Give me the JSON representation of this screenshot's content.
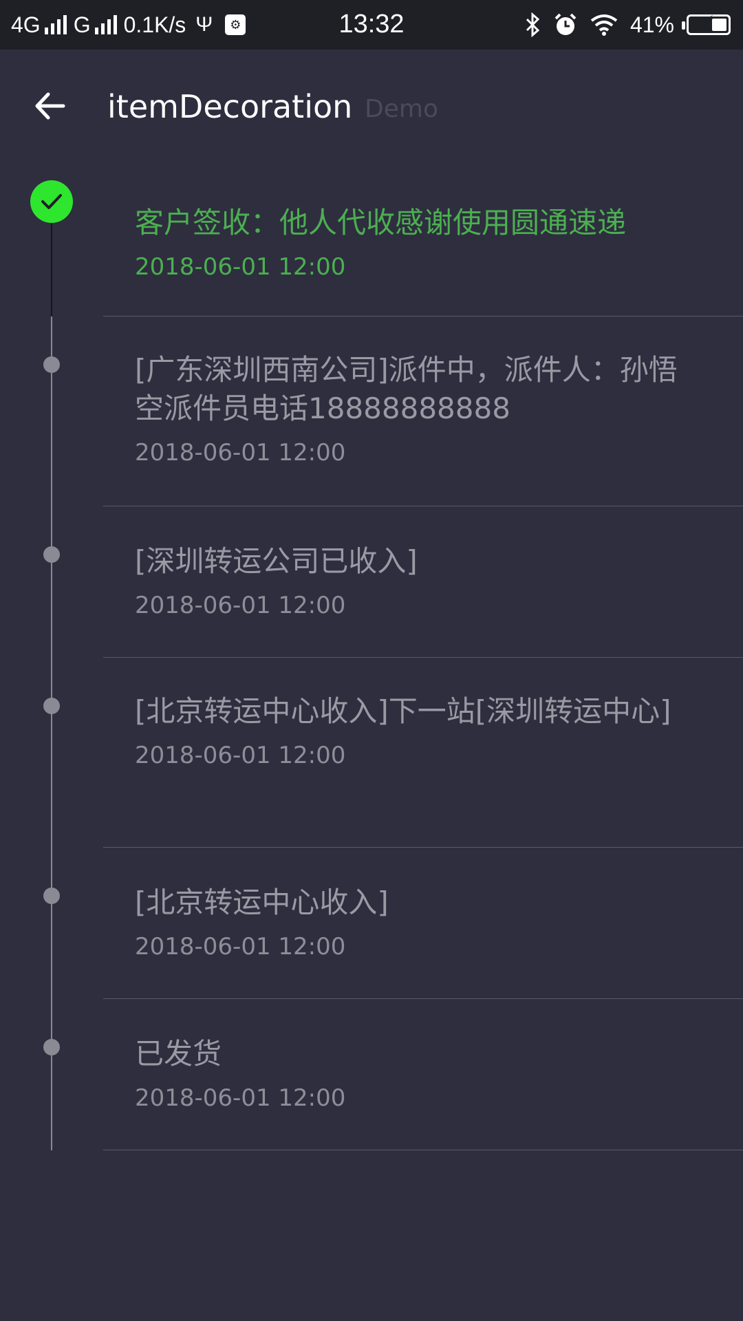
{
  "status_bar": {
    "network1": "4G",
    "network2": "G",
    "speed": "0.1K/s",
    "time": "13:32",
    "battery": "41%",
    "battery_level": 0.41
  },
  "toolbar": {
    "title": "itemDecoration",
    "subtitle": "Demo"
  },
  "colors": {
    "background": "#2e2e3f",
    "status_bar": "#1f1f26",
    "active_green": "#4caf50",
    "check_green": "#2ee62e",
    "inactive_text": "#9a9aa4"
  },
  "timeline": [
    {
      "title": "客户签收：他人代收感谢使用圆通速递",
      "time": "2018-06-01 12:00",
      "active": true
    },
    {
      "title": "[广东深圳西南公司]派件中，派件人：孙悟空派件员电话18888888888",
      "time": "2018-06-01 12:00",
      "active": false
    },
    {
      "title": "[深圳转运公司已收入]",
      "time": "2018-06-01 12:00",
      "active": false
    },
    {
      "title": "[北京转运中心收入]下一站[深圳转运中心]",
      "time": "2018-06-01 12:00",
      "active": false
    },
    {
      "title": "[北京转运中心收入]",
      "time": "2018-06-01 12:00",
      "active": false
    },
    {
      "title": "已发货",
      "time": "2018-06-01 12:00",
      "active": false
    }
  ]
}
